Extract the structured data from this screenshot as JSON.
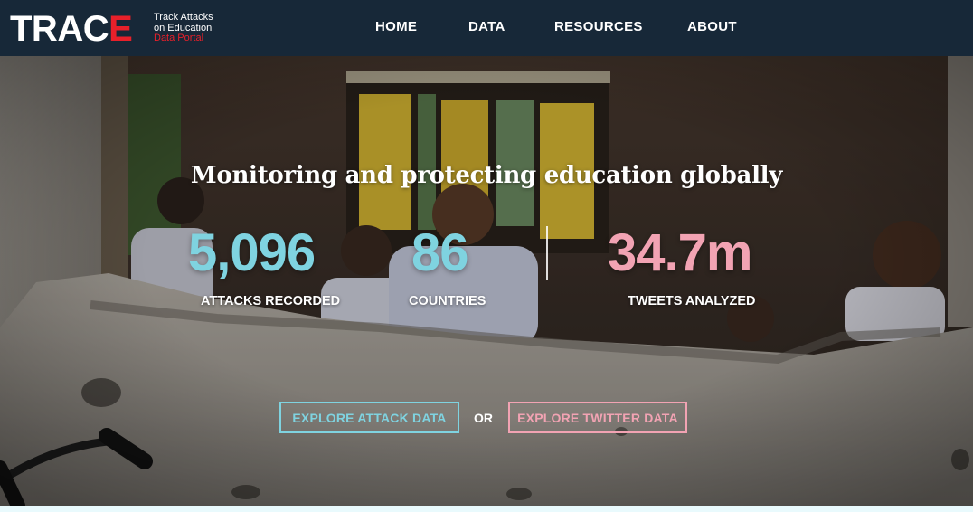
{
  "brand": {
    "name_part1": "TRAC",
    "name_part2": "E",
    "tagline_line1": "Track Attacks",
    "tagline_line2": "on Education",
    "tagline_line3": "Data Portal"
  },
  "nav": {
    "items": [
      {
        "label": "HOME"
      },
      {
        "label": "DATA"
      },
      {
        "label": "RESOURCES"
      },
      {
        "label": "ABOUT"
      }
    ]
  },
  "hero": {
    "title": "Monitoring and protecting education globally",
    "stats": [
      {
        "value": "5,096",
        "label": "ATTACKS RECORDED",
        "color": "#7fd3e0"
      },
      {
        "value": "86",
        "label": "COUNTRIES",
        "color": "#7fd3e0"
      },
      {
        "value": "34.7m",
        "label": "TWEETS ANALYZED",
        "color": "#f2a3b3"
      }
    ],
    "cta_attack": "EXPLORE ATTACK DATA",
    "cta_or": "OR",
    "cta_twitter": "EXPLORE TWITTER DATA"
  },
  "colors": {
    "header_bg": "#172838",
    "brand_red": "#e8202a",
    "accent_teal": "#7fd3e0",
    "accent_pink": "#f2a3b3"
  }
}
